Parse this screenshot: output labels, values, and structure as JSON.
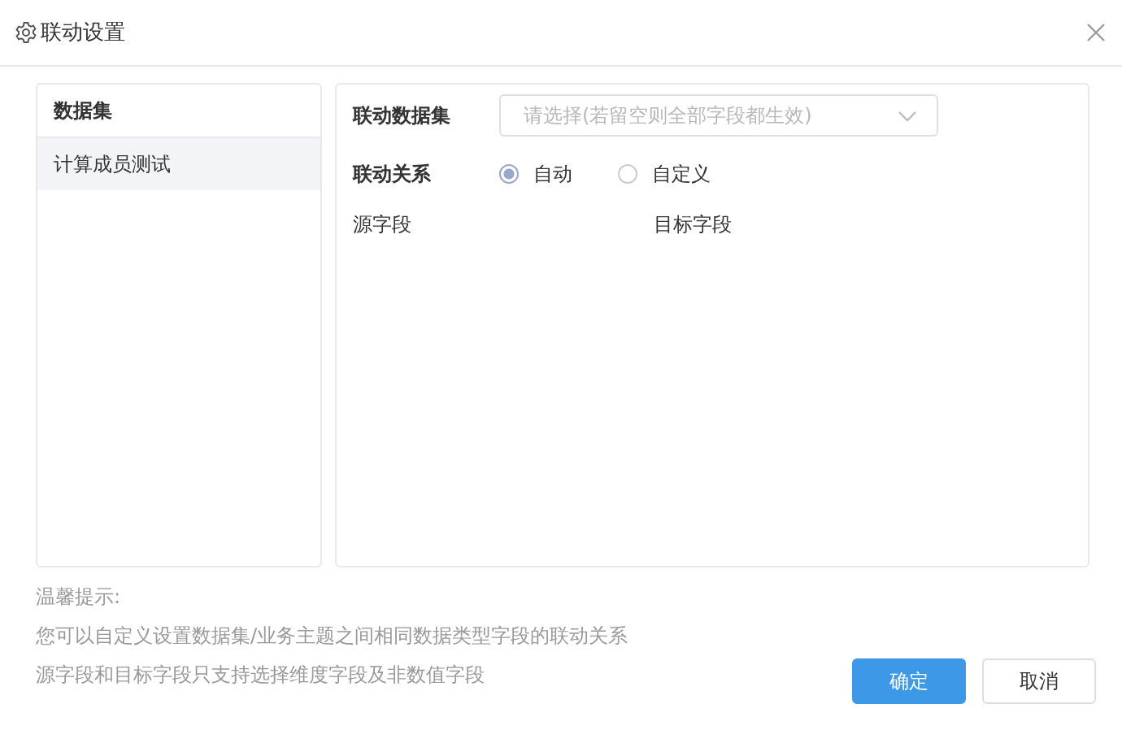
{
  "window": {
    "title": "联动设置"
  },
  "dataset_list": {
    "header": "数据集",
    "items": [
      {
        "label": "计算成员测试",
        "selected": true
      }
    ]
  },
  "form": {
    "dataset_label": "联动数据集",
    "dataset_select": {
      "placeholder": "请选择(若留空则全部字段都生效)"
    },
    "relation_label": "联动关系",
    "relation_options": [
      {
        "label": "自动",
        "selected": true
      },
      {
        "label": "自定义",
        "selected": false
      }
    ],
    "columns": [
      "源字段",
      "目标字段"
    ]
  },
  "hints": [
    "温馨提示:",
    "您可以自定义设置数据集/业务主题之间相同数据类型字段的联动关系",
    "源字段和目标字段只支持选择维度字段及非数值字段"
  ],
  "buttons": [
    {
      "label": "确定",
      "kind": "primary"
    },
    {
      "label": "取消",
      "kind": "default"
    }
  ]
}
